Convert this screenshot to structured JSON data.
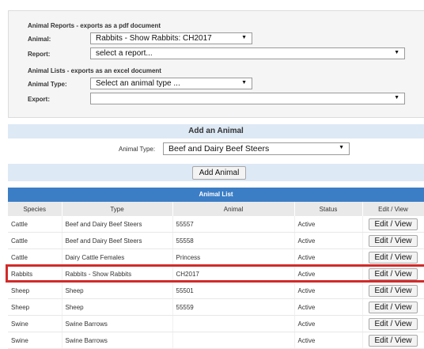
{
  "reports": {
    "section_title": "Animal Reports - exports as a pdf document",
    "animal_label": "Animal:",
    "animal_value": "Rabbits - Show Rabbits: CH2017",
    "report_label": "Report:",
    "report_value": "select a report..."
  },
  "lists": {
    "section_title": "Animal Lists - exports as an excel document",
    "type_label": "Animal Type:",
    "type_value": "Select an animal type ...",
    "export_label": "Export:",
    "export_value": ""
  },
  "add_animal": {
    "title": "Add an Animal",
    "type_label": "Animal Type:",
    "type_value": "Beef and Dairy Beef Steers",
    "button_label": "Add Animal"
  },
  "animal_list": {
    "title": "Animal List",
    "columns": [
      "Species",
      "Type",
      "Animal",
      "Status",
      "Edit / View"
    ],
    "rows": [
      {
        "species": "Cattle",
        "type": "Beef and Dairy Beef Steers",
        "animal": "55557",
        "status": "Active",
        "action": "Edit / View"
      },
      {
        "species": "Cattle",
        "type": "Beef and Dairy Beef Steers",
        "animal": "55558",
        "status": "Active",
        "action": "Edit / View"
      },
      {
        "species": "Cattle",
        "type": "Dairy Cattle Females",
        "animal": "Princess",
        "status": "Active",
        "action": "Edit / View"
      },
      {
        "species": "Rabbits",
        "type": "Rabbits - Show Rabbits",
        "animal": "CH2017",
        "status": "Active",
        "action": "Edit / View"
      },
      {
        "species": "Sheep",
        "type": "Sheep",
        "animal": "55501",
        "status": "Active",
        "action": "Edit / View"
      },
      {
        "species": "Sheep",
        "type": "Sheep",
        "animal": "55559",
        "status": "Active",
        "action": "Edit / View"
      },
      {
        "species": "Swine",
        "type": "Swine Barrows",
        "animal": "",
        "status": "Active",
        "action": "Edit / View"
      },
      {
        "species": "Swine",
        "type": "Swine Barrows",
        "animal": "",
        "status": "Active",
        "action": "Edit / View"
      }
    ]
  },
  "icons": {
    "dropdown": "dropdown-arrow-icon"
  },
  "colors": {
    "list_header": "#3c7ec5",
    "highlight": "#d22a2a",
    "panel_blue": "#dde9f5"
  }
}
